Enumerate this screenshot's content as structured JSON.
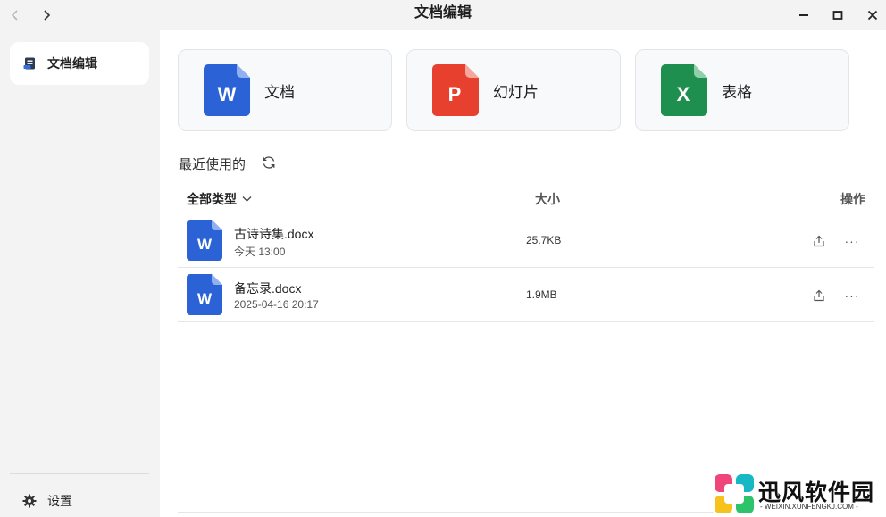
{
  "window": {
    "title": "文档编辑"
  },
  "sidebar": {
    "items": [
      {
        "label": "文档编辑",
        "icon": "document-edit-icon",
        "active": true
      }
    ],
    "settings_label": "设置"
  },
  "create_cards": [
    {
      "label": "文档",
      "icon_letter": "W",
      "color": "#2b63d6"
    },
    {
      "label": "幻灯片",
      "icon_letter": "P",
      "color": "#e8402f"
    },
    {
      "label": "表格",
      "icon_letter": "X",
      "color": "#1e8f4e"
    }
  ],
  "recent": {
    "title": "最近使用的",
    "columns": {
      "type": "全部类型",
      "size": "大小",
      "actions": "操作"
    },
    "files": [
      {
        "name": "古诗诗集.docx",
        "time": "今天 13:00",
        "size": "25.7KB",
        "icon_letter": "W"
      },
      {
        "name": "备忘录.docx",
        "time": "2025-04-16 20:17",
        "size": "1.9MB",
        "icon_letter": "W"
      }
    ],
    "more_glyph": "···"
  },
  "watermark": {
    "name": "迅风软件园",
    "url": "- WEIXIN.XUNFENGKJ.COM -"
  }
}
